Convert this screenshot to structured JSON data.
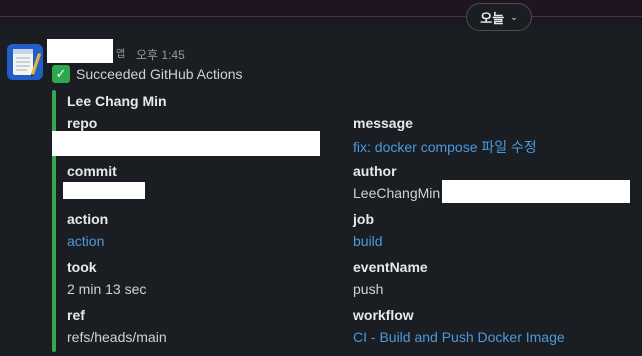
{
  "header": {
    "date_label": "오늘",
    "date_chevron": "⌄"
  },
  "message": {
    "avatar_icon": "notepad-app-icon",
    "app_badge": "앱",
    "timestamp": "오후 1:45",
    "status_icon": "white-check-mark-icon",
    "status_text": "Succeeded GitHub Actions",
    "attachment_color": "#36a64f",
    "author": "Lee Chang Min",
    "fields": {
      "repo": {
        "title": "repo",
        "value": ""
      },
      "message": {
        "title": "message",
        "value": "fix: docker compose 파일 수정"
      },
      "commit": {
        "title": "commit",
        "value": ""
      },
      "author": {
        "title": "author",
        "value": "LeeChangMin"
      },
      "action": {
        "title": "action",
        "value": "action"
      },
      "job": {
        "title": "job",
        "value": "build"
      },
      "took": {
        "title": "took",
        "value": "2 min 13 sec"
      },
      "eventName": {
        "title": "eventName",
        "value": "push"
      },
      "ref": {
        "title": "ref",
        "value": "refs/heads/main"
      },
      "workflow": {
        "title": "workflow",
        "value": "CI - Build and Push Docker Image"
      }
    }
  }
}
